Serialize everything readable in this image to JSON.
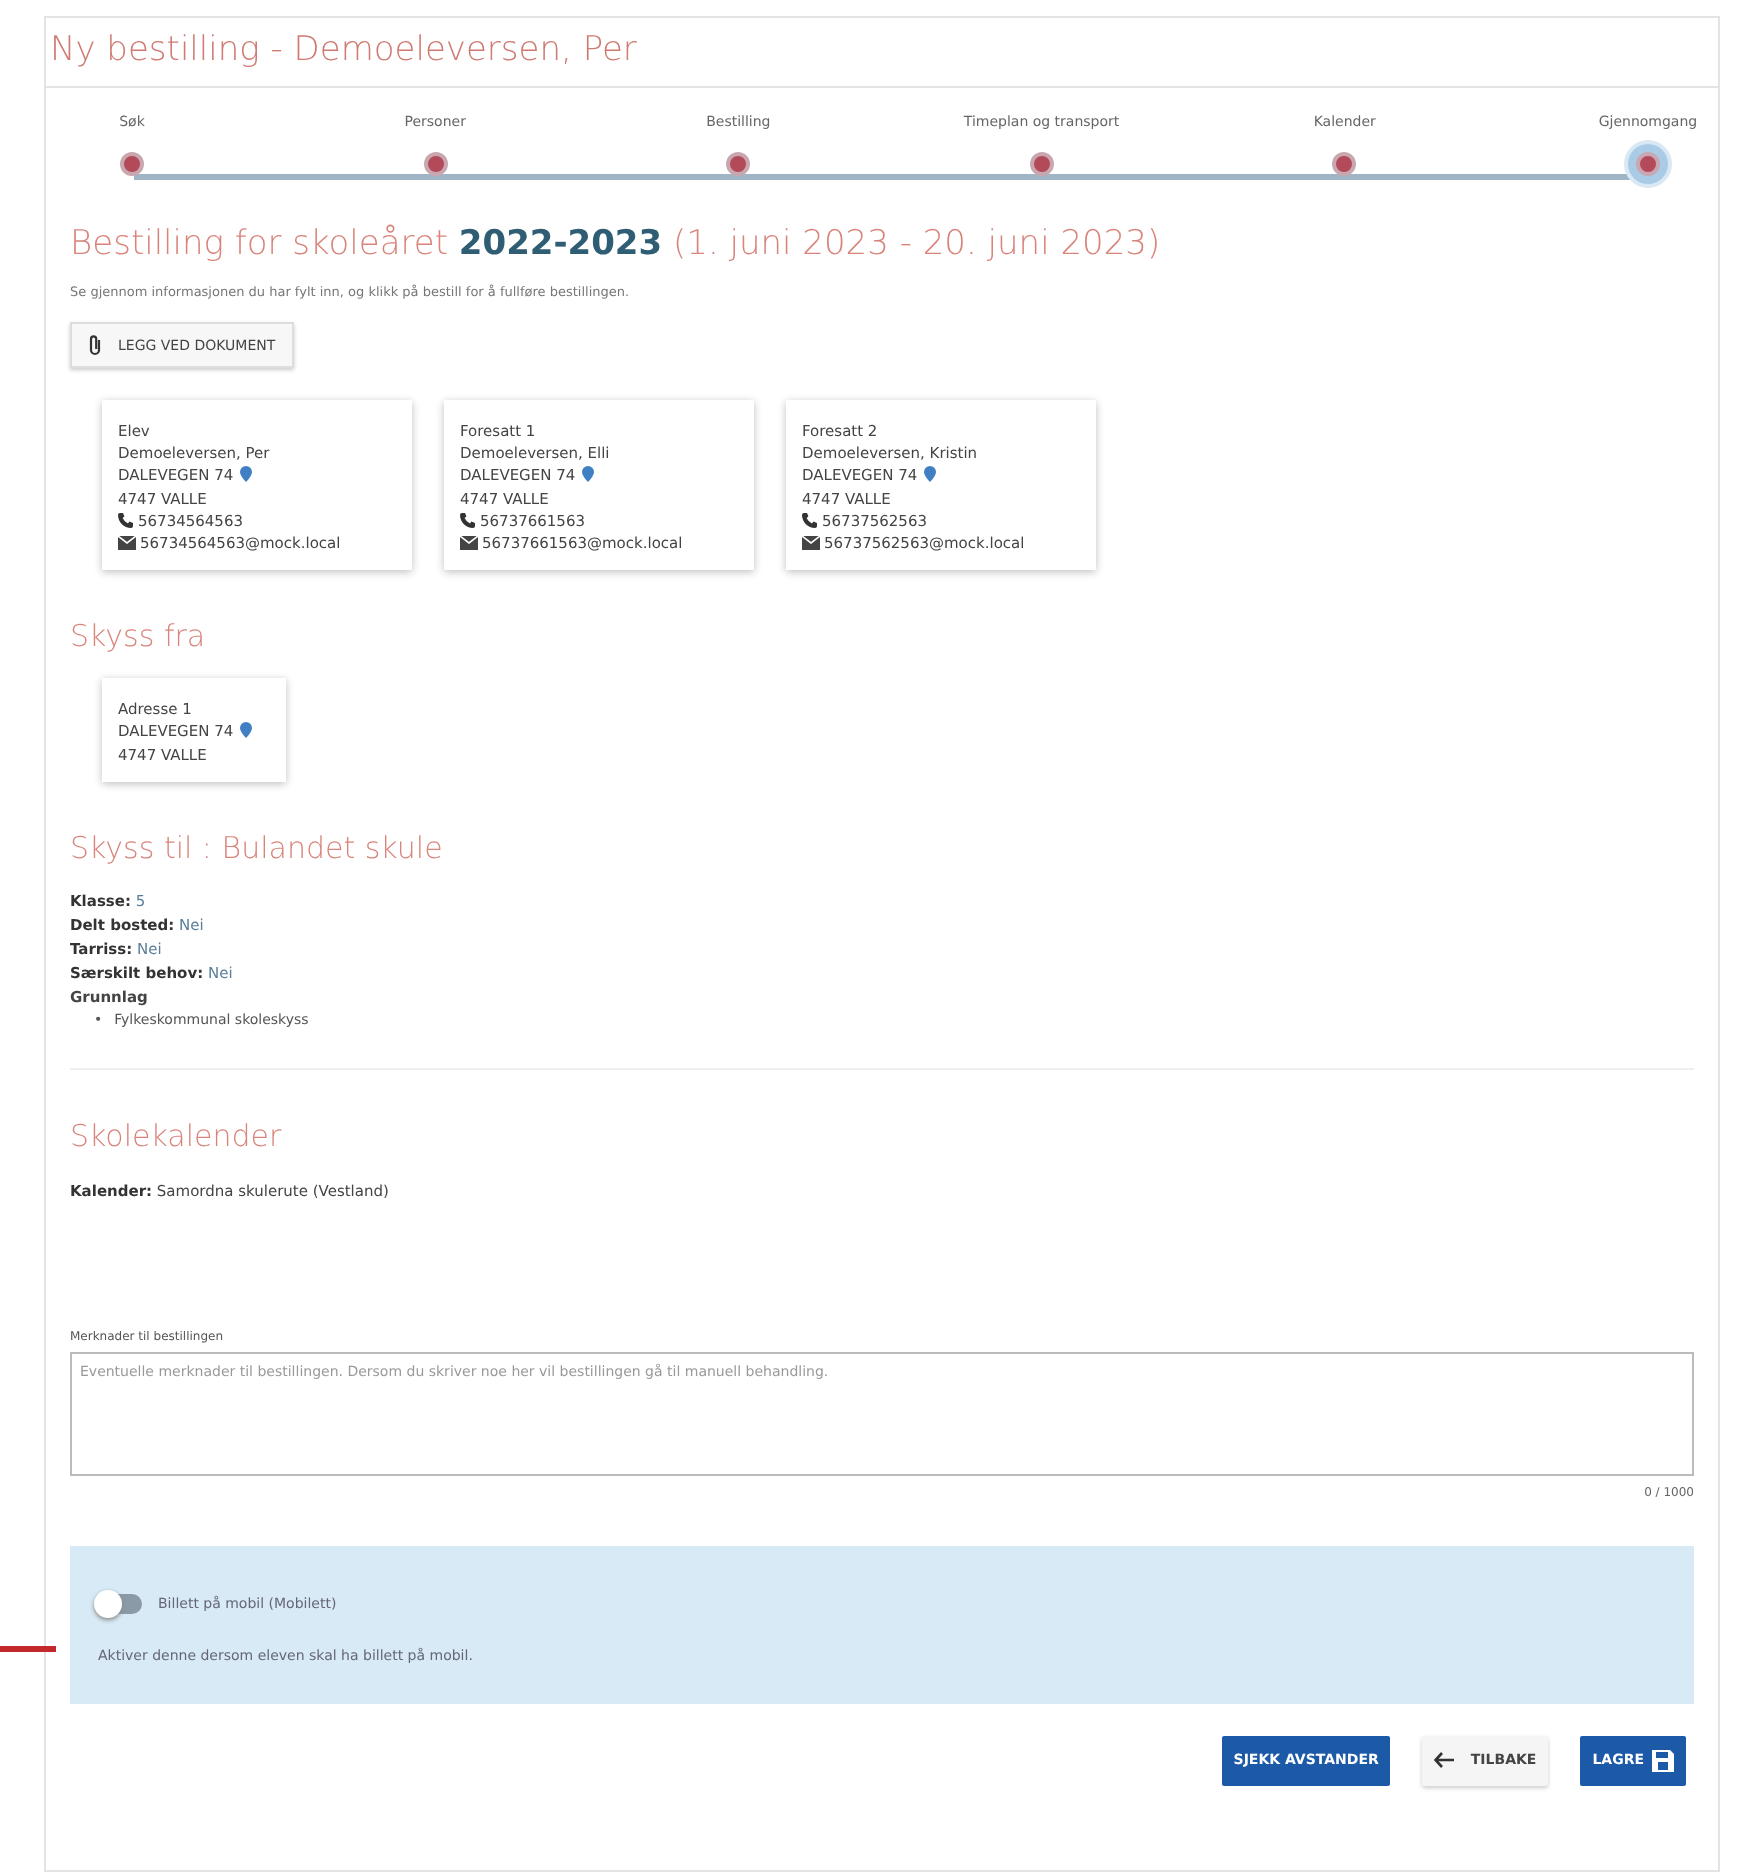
{
  "title": "Ny bestilling - Demoeleversen, Per",
  "steps": [
    {
      "label": "Søk",
      "selected": false
    },
    {
      "label": "Personer",
      "selected": false
    },
    {
      "label": "Bestilling",
      "selected": false
    },
    {
      "label": "Timeplan og transport",
      "selected": false
    },
    {
      "label": "Kalender",
      "selected": false
    },
    {
      "label": "Gjennomgang",
      "selected": true
    }
  ],
  "heading": "Bestilling for skoleåret **2022-2023** (1. juni 2023 - 20. juni 2023)",
  "intro": "Se gjennom informasjonen du har fylt inn, og klikk på bestill for å fullføre bestillingen.",
  "attach_button": "LEGG VED DOKUMENT",
  "persons": [
    {
      "role": "Elev",
      "name": "Demoeleversen, Per",
      "street": "DALEVEGEN 74",
      "city": "4747 VALLE",
      "phone": "56734564563",
      "email": "56734564563@mock.local"
    },
    {
      "role": "Foresatt 1",
      "name": "Demoeleversen, Elli",
      "street": "DALEVEGEN 74",
      "city": "4747 VALLE",
      "phone": "56737661563",
      "email": "56737661563@mock.local"
    },
    {
      "role": "Foresatt 2",
      "name": "Demoeleversen, Kristin",
      "street": "DALEVEGEN 74",
      "city": "4747 VALLE",
      "phone": "56737562563",
      "email": "56737562563@mock.local"
    }
  ],
  "from_section": {
    "title": "Skyss fra",
    "addresses": [
      {
        "label": "Adresse 1",
        "street": "DALEVEGEN 74",
        "city": "4747 VALLE"
      }
    ]
  },
  "to_section": {
    "title": "Skyss til : Bulandet skule",
    "facts": [
      {
        "label": "Klasse:",
        "value": "5"
      },
      {
        "label": "Delt bosted:",
        "value": "Nei"
      },
      {
        "label": "Tarriss:",
        "value": "Nei"
      },
      {
        "label": "Særskilt behov:",
        "value": "Nei"
      }
    ],
    "basis_label": "Grunnlag",
    "basis": [
      {
        "marker": "•",
        "text": "Fylkeskommunal skoleskyss"
      }
    ]
  },
  "calendar": {
    "title": "Skolekalender",
    "label": "Kalender:",
    "value": "Samordna skulerute (Vestland)"
  },
  "remarks": {
    "label": "Merknader til bestillingen",
    "placeholder": "Eventuelle merknader til bestillingen. Dersom du skriver noe her vil bestillingen gå til manuell behandling.",
    "counter": "0 / 1000"
  },
  "mobile_ticket": {
    "label": "Billett på mobil (Mobilett)",
    "on": false,
    "help": "Aktiver denne dersom eleven skal ha billett på mobil."
  },
  "buttons": [
    {
      "label": "SJEKK AVSTANDER",
      "kind": "primary"
    },
    {
      "label": "TILBAKE",
      "kind": "back"
    },
    {
      "label": "LAGRE",
      "kind": "save"
    }
  ]
}
